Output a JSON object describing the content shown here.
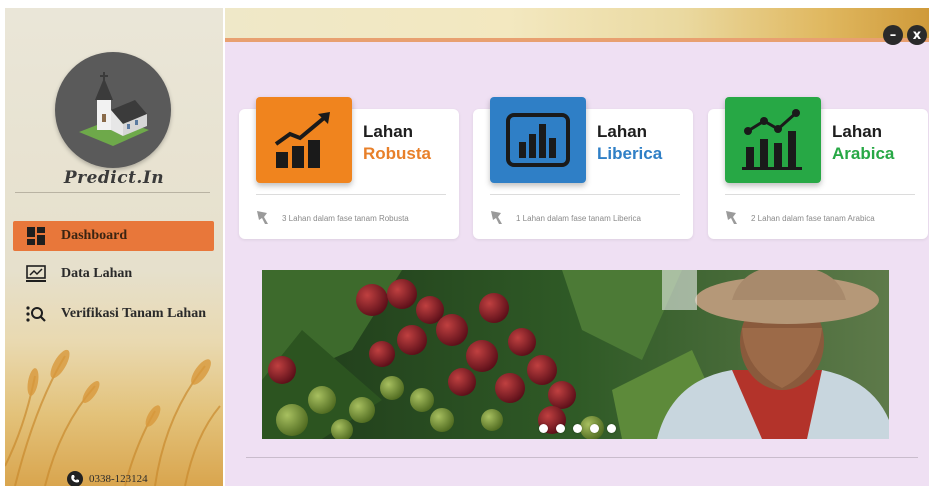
{
  "brand": "Predict.In",
  "sidebar": {
    "items": [
      {
        "label": "Dashboard",
        "icon": "dashboard-grid-icon",
        "active": true
      },
      {
        "label": "Data Lahan",
        "icon": "monitor-chart-icon",
        "active": false
      },
      {
        "label": "Verifikasi Tanam Lahan",
        "icon": "list-search-icon",
        "active": false
      }
    ],
    "phone": "0338-123124"
  },
  "window_controls": {
    "minimize": "–",
    "close": "x"
  },
  "cards": [
    {
      "title": "Lahan",
      "subtitle": "Robusta",
      "color": "#f0841e",
      "subtitle_color": "#e8802a",
      "icon": "rising-bar-chart-icon",
      "footer": "3 Lahan dalam fase tanam Robusta"
    },
    {
      "title": "Lahan",
      "subtitle": "Liberica",
      "color": "#2f7fc6",
      "subtitle_color": "#2f7fc6",
      "icon": "framed-bar-chart-icon",
      "footer": "1 Lahan dalam fase tanam Liberica"
    },
    {
      "title": "Lahan",
      "subtitle": "Arabica",
      "color": "#27a845",
      "subtitle_color": "#27a845",
      "icon": "line-bar-chart-icon",
      "footer": "2 Lahan dalam fase tanam Arabica"
    }
  ],
  "banner": {
    "slides": 5,
    "active_slide": 1
  },
  "colors": {
    "accent": "#e8773a",
    "main_bg": "#efe0f3"
  }
}
